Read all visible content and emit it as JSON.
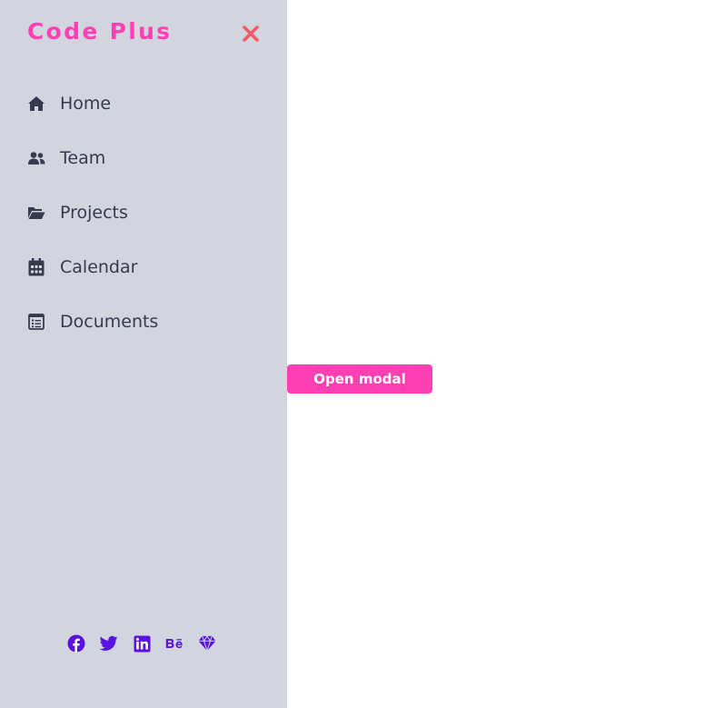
{
  "brand": {
    "title": "Code Plus",
    "color": "#ff40b4"
  },
  "sidebar": {
    "background": "#d3d5de",
    "close_icon": "close-icon",
    "close_color": "#f25a6a",
    "items": [
      {
        "label": "Home",
        "icon": "home-icon"
      },
      {
        "label": "Team",
        "icon": "users-icon"
      },
      {
        "label": "Projects",
        "icon": "folder-open-icon"
      },
      {
        "label": "Calendar",
        "icon": "calendar-icon"
      },
      {
        "label": "Documents",
        "icon": "document-list-icon"
      }
    ],
    "social": [
      {
        "icon": "facebook-icon"
      },
      {
        "icon": "twitter-icon"
      },
      {
        "icon": "linkedin-icon"
      },
      {
        "icon": "behance-icon"
      },
      {
        "icon": "sketch-icon"
      }
    ],
    "social_color": "#5a12e0"
  },
  "main": {
    "open_modal_label": "Open modal",
    "button_color": "#ff40b4"
  }
}
